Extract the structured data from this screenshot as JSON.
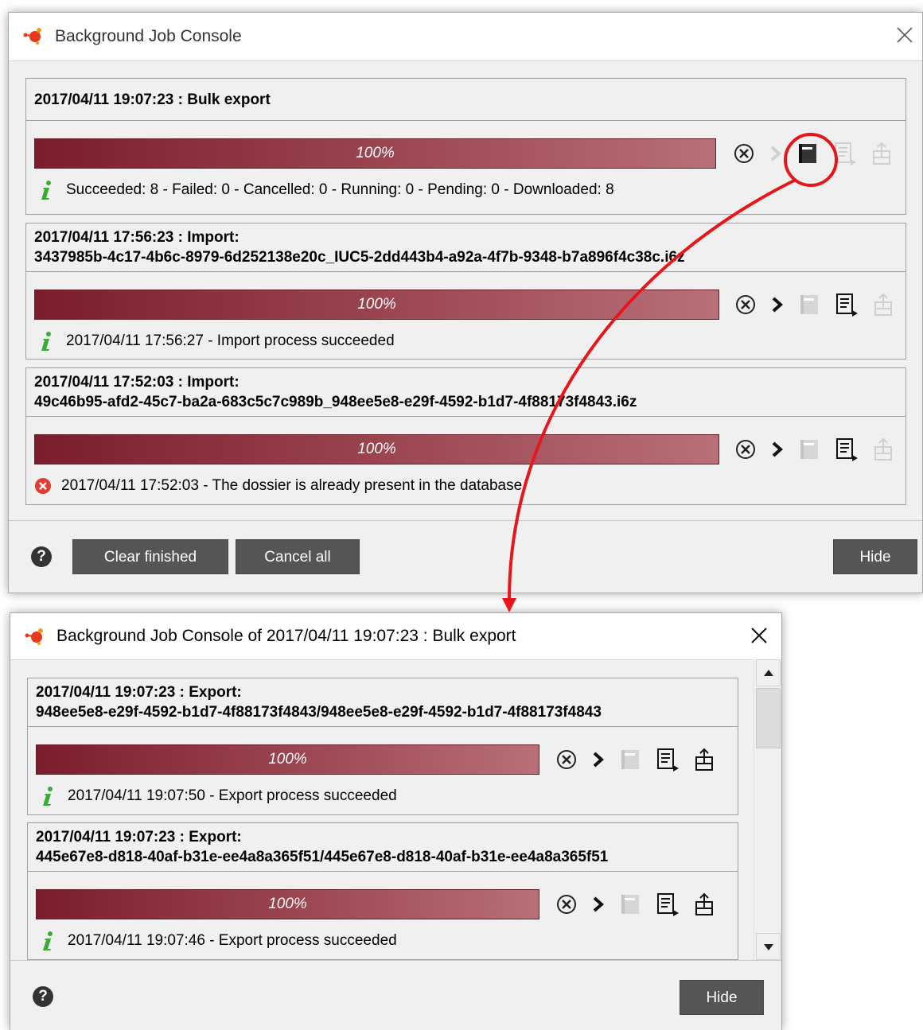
{
  "console": {
    "title": "Background Job Console",
    "jobs": [
      {
        "header": "2017/04/11 19:07:23 : Bulk export",
        "progress_label": "100%",
        "progress": 1.0,
        "status_type": "info",
        "status_text": "Succeeded: 8 - Failed: 0 - Cancelled: 0 - Running: 0 - Pending: 0 - Downloaded: 8"
      },
      {
        "header_line1": "2017/04/11 17:56:23 : Import:",
        "header_line2": "3437985b-4c17-4b6c-8979-6d252138e20c_IUC5-2dd443b4-a92a-4f7b-9348-b7a896f4c38c.i6z",
        "progress_label": "100%",
        "progress": 1.0,
        "status_type": "info",
        "status_text": "2017/04/11 17:56:27 - Import process succeeded"
      },
      {
        "header_line1": "2017/04/11 17:52:03 : Import:",
        "header_line2": "49c46b95-afd2-45c7-ba2a-683c5c7c989b_948ee5e8-e29f-4592-b1d7-4f88173f4843.i6z",
        "progress_label": "100%",
        "progress": 1.0,
        "status_type": "error",
        "status_text": "2017/04/11 17:52:03 - The dossier is already present in the database"
      }
    ],
    "footer": {
      "clear_label": "Clear finished",
      "cancel_label": "Cancel all",
      "hide_label": "Hide"
    }
  },
  "subconsole": {
    "title": "Background Job Console of 2017/04/11 19:07:23 : Bulk export",
    "jobs": [
      {
        "header_line1": "2017/04/11 19:07:23 : Export:",
        "header_line2": "948ee5e8-e29f-4592-b1d7-4f88173f4843/948ee5e8-e29f-4592-b1d7-4f88173f4843",
        "progress_label": "100%",
        "progress": 1.0,
        "status_type": "info",
        "status_text": "2017/04/11 19:07:50 - Export process succeeded"
      },
      {
        "header_line1": "2017/04/11 19:07:23 : Export:",
        "header_line2": "445e67e8-d818-40af-b31e-ee4a8a365f51/445e67e8-d818-40af-b31e-ee4a8a365f51",
        "progress_label": "100%",
        "progress": 1.0,
        "status_type": "info",
        "status_text": "2017/04/11 19:07:46 - Export process succeeded"
      }
    ],
    "footer": {
      "hide_label": "Hide"
    }
  },
  "colors": {
    "progress_start": "#7a1d2c",
    "progress_end": "#b87078",
    "info_icon": "#3aaa35",
    "error_icon": "#e03c31",
    "annotation": "#e8161b",
    "button_bg": "#555555"
  }
}
